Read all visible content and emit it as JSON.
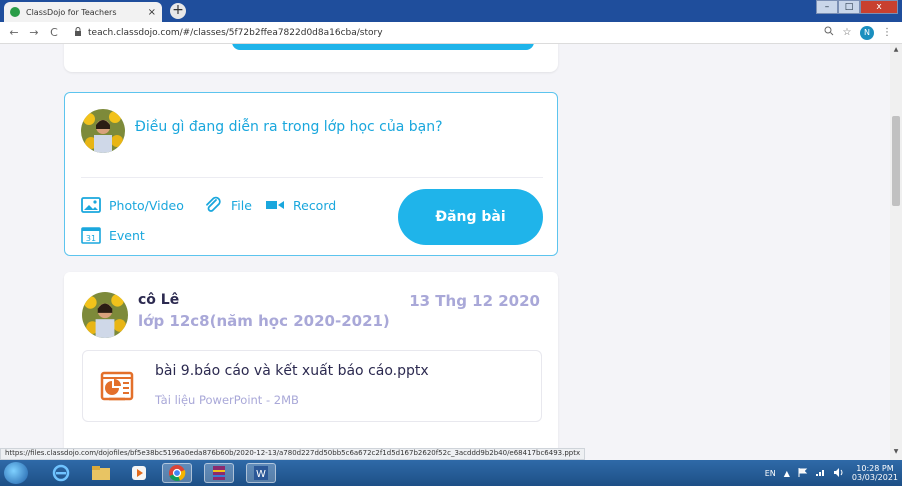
{
  "browser": {
    "tab_title": "ClassDojo for Teachers",
    "tab_close": "×",
    "new_tab": "+",
    "url": "teach.classdojo.com/#/classes/5f72b2ffea7822d0d8a16cba/story",
    "back": "←",
    "forward": "→",
    "reload": "C",
    "profile_initial": "N",
    "min": "–",
    "max": "□",
    "close": "x"
  },
  "composer": {
    "prompt": "Điều gì đang diễn ra trong lớp học của bạn?",
    "photo_video": "Photo/Video",
    "file": "File",
    "record": "Record",
    "event": "Event",
    "event_day": "31",
    "post_button": "Đăng bài"
  },
  "post": {
    "author": "cô Lê",
    "class_name": "lớp 12c8(năm học 2020-2021)",
    "date": "13 Thg 12 2020",
    "attachment": {
      "name": "bài 9.báo cáo và kết xuất báo cáo.pptx",
      "type": "Tài liệu PowerPoint - 2MB"
    }
  },
  "status_url": "https://files.classdojo.com/dojofiles/bf5e38bc5196a0eda876b60b/2020-12-13/a780d227dd50bb5c6a672c2f1d5d167b2620f52c_3acddd9b2b40/e68417bc6493.pptx",
  "taskbar": {
    "lang": "EN",
    "time": "10:28 PM",
    "date": "03/03/2021"
  },
  "colors": {
    "accent": "#1fb4ea",
    "muted": "#a9a8d8",
    "text": "#2c2a50",
    "ppt": "#e3702b"
  }
}
